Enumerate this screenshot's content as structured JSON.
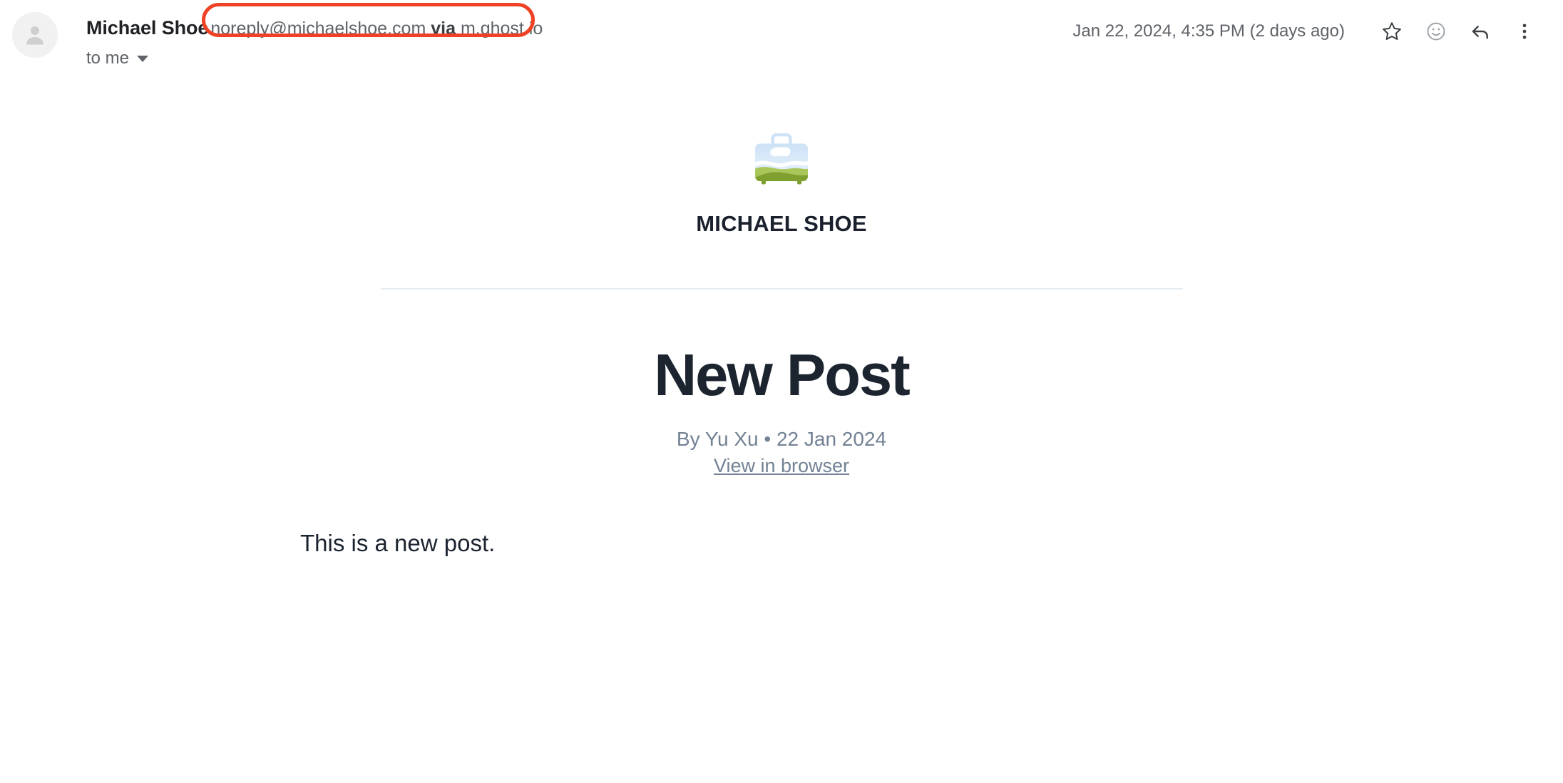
{
  "header": {
    "avatar_icon": "person-avatar-icon",
    "sender_name": "Michael Shoe",
    "sender_email": "noreply@michaelshoe.com",
    "sender_via_label": "via",
    "sender_via_domain": "m.ghost.io",
    "recipient": "to me",
    "recipient_caret_icon": "chevron-down-icon",
    "timestamp": "Jan 22, 2024, 4:35 PM (2 days ago)",
    "actions": [
      {
        "name": "star-icon",
        "label": "Star"
      },
      {
        "name": "emoji-reaction-icon",
        "label": "Add reaction"
      },
      {
        "name": "reply-icon",
        "label": "Reply"
      },
      {
        "name": "more-options-icon",
        "label": "More"
      }
    ],
    "annotation_color": "#ef4123"
  },
  "newsletter": {
    "logo_icon": "briefcase-landscape-logo-icon",
    "brand_title": "MICHAEL SHOE",
    "post_title": "New Post",
    "byline": "By Yu Xu • 22 Jan 2024",
    "view_in_browser": "View in browser",
    "body_text": "This is a new post."
  },
  "colors": {
    "accent_red": "#ef4123",
    "text_dark": "#1c2430",
    "text_muted": "#5f6368",
    "text_slate": "#738294",
    "divider": "#e7ecf0",
    "logo_sky": "#cfe4f7",
    "logo_sky_light": "#e3f0fb",
    "logo_hill_light": "#a8c65a",
    "logo_hill_dark": "#7fa02e"
  }
}
